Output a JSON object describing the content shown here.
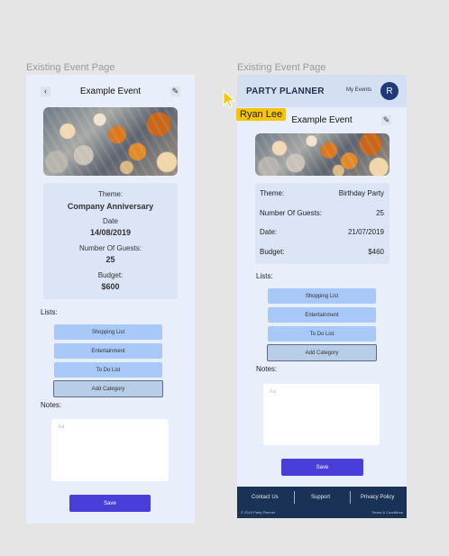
{
  "frame1": {
    "label": "Existing Event Page",
    "header": {
      "title": "Example Event",
      "back_icon": "chevron-left-icon",
      "edit_icon": "pencil-icon"
    },
    "details": [
      {
        "label": "Theme:",
        "value": "Company Anniversary"
      },
      {
        "label": "Date",
        "value": "14/08/2019"
      },
      {
        "label": "Number Of Guests:",
        "value": "25"
      },
      {
        "label": "Budget:",
        "value": "$600"
      }
    ],
    "lists": {
      "label": "Lists:",
      "items": [
        "Shopping List",
        "Entertainment",
        "To Do List"
      ],
      "add_label": "Add Category"
    },
    "notes": {
      "label": "Notes:",
      "placeholder": "Aa"
    },
    "save_label": "Save"
  },
  "frame2": {
    "label": "Existing Event Page",
    "topbar": {
      "brand": "PARTY PLANNER",
      "my_events": "My Events",
      "avatar_initial": "R"
    },
    "title_partial": "Example Event",
    "details": [
      {
        "label": "Theme:",
        "value": "Birthday Party"
      },
      {
        "label": "Number Of Guests:",
        "value": "25"
      },
      {
        "label": "Date:",
        "value": "21/07/2019"
      },
      {
        "label": "Budget:",
        "value": "$460"
      }
    ],
    "lists": {
      "label": "Lists:",
      "items": [
        "Shopping List",
        "Entertainment",
        "To Do List"
      ],
      "add_label": "Add Category"
    },
    "notes": {
      "label": "Notes:",
      "placeholder": "Aa"
    },
    "save_label": "Save",
    "footer": {
      "links": [
        "Contact Us",
        "Support",
        "Privacy Policy"
      ],
      "copyright": "© 2019 Party Planner",
      "terms": "Terms & Conditions"
    }
  },
  "overlay": {
    "tooltip_name": "Ryan Lee",
    "tooltip_color": "#f5c400"
  },
  "colors": {
    "accent": "#4a3edb",
    "list_button": "#a8c8f8",
    "navy": "#1a3256"
  }
}
